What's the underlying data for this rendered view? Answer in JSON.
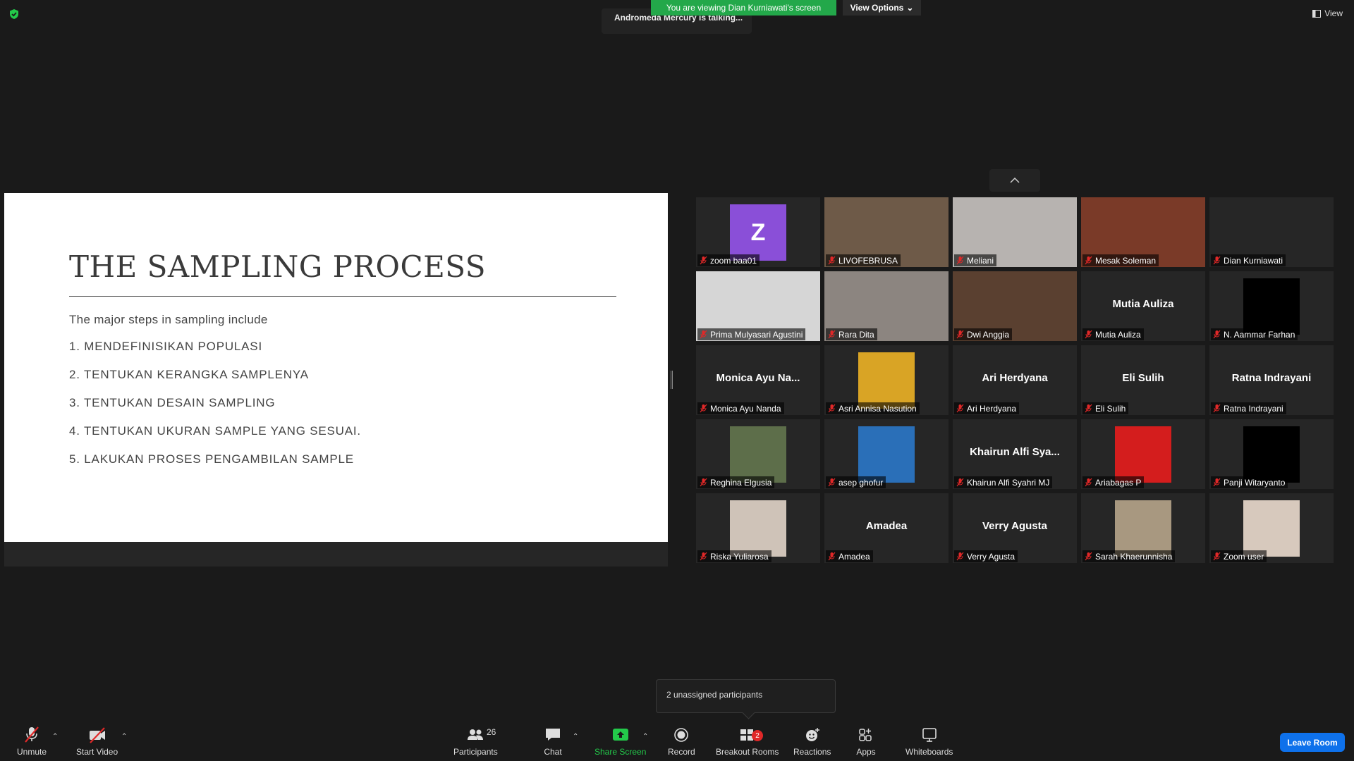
{
  "top": {
    "viewing_banner": "You are viewing Dian Kurniawati's screen",
    "view_options": "View Options",
    "talking": "Andromeda Mercury is talking...",
    "view_button": "View"
  },
  "slide": {
    "title": "THE SAMPLING PROCESS",
    "intro": "The major steps in sampling include",
    "steps": [
      "1. MENDEFINISIKAN POPULASI",
      "2. TENTUKAN KERANGKA SAMPLENYA",
      "3. TENTUKAN DESAIN SAMPLING",
      "4. TENTUKAN UKURAN SAMPLE YANG SESUAI.",
      "5. LAKUKAN PROSES PENGAMBILAN SAMPLE"
    ]
  },
  "gallery": [
    {
      "label": "zoom baa01",
      "center": "",
      "kind": "avatar",
      "avatar_letter": "Z"
    },
    {
      "label": "LIVOFEBRUSA",
      "center": "",
      "kind": "video",
      "video_color": "#6e5a48"
    },
    {
      "label": "Meliani",
      "center": "",
      "kind": "video",
      "video_color": "#b7b3b0"
    },
    {
      "label": "Mesak Soleman",
      "center": "",
      "kind": "video",
      "video_color": "#7a3a28"
    },
    {
      "label": "Dian Kurniawati",
      "center": "",
      "kind": "empty"
    },
    {
      "label": "Prima Mulyasari Agustini",
      "center": "",
      "kind": "video",
      "video_color": "#d6d6d6"
    },
    {
      "label": "Rara Dita",
      "center": "",
      "kind": "video",
      "video_color": "#8c8580"
    },
    {
      "label": "Dwi Anggia",
      "center": "",
      "kind": "video",
      "video_color": "#5a4030"
    },
    {
      "label": "Mutia Auliza",
      "center": "Mutia Auliza",
      "kind": "name"
    },
    {
      "label": "N. Aammar Farhan",
      "center": "",
      "kind": "pic",
      "pic_color": "#000000"
    },
    {
      "label": "Monica Ayu Nanda",
      "center": "Monica Ayu Na...",
      "kind": "name"
    },
    {
      "label": "Asri Annisa Nasution",
      "center": "",
      "kind": "pic",
      "pic_color": "#d9a425"
    },
    {
      "label": "Ari Herdyana",
      "center": "Ari Herdyana",
      "kind": "name"
    },
    {
      "label": "Eli Sulih",
      "center": "Eli Sulih",
      "kind": "name"
    },
    {
      "label": "Ratna Indrayani",
      "center": "Ratna Indrayani",
      "kind": "name"
    },
    {
      "label": "Reghina Elgusia",
      "center": "",
      "kind": "pic",
      "pic_color": "#5d6e4a"
    },
    {
      "label": "asep ghofur",
      "center": "",
      "kind": "pic",
      "pic_color": "#2a6fb8"
    },
    {
      "label": "Khairun Alfi Syahri MJ",
      "center": "Khairun Alfi Sya...",
      "kind": "name"
    },
    {
      "label": "Ariabagas P",
      "center": "",
      "kind": "pic",
      "pic_color": "#d41d1d"
    },
    {
      "label": "Panji Witaryanto",
      "center": "",
      "kind": "pic",
      "pic_color": "#000000"
    },
    {
      "label": "Riska Yuliarosa",
      "center": "",
      "kind": "pic",
      "pic_color": "#cfc3b8"
    },
    {
      "label": "Amadea",
      "center": "Amadea",
      "kind": "name"
    },
    {
      "label": "Verry Agusta",
      "center": "Verry Agusta",
      "kind": "name"
    },
    {
      "label": "Sarah Khaerunnisha",
      "center": "",
      "kind": "pic",
      "pic_color": "#a89880"
    },
    {
      "label": "Zoom user",
      "center": "",
      "kind": "pic",
      "pic_color": "#d7c9bd"
    }
  ],
  "unassigned": "2 unassigned participants",
  "toolbar": {
    "unmute": "Unmute",
    "start_video": "Start Video",
    "participants": "Participants",
    "participants_count": "26",
    "chat": "Chat",
    "share_screen": "Share Screen",
    "record": "Record",
    "breakout_rooms": "Breakout Rooms",
    "breakout_count": "2",
    "reactions": "Reactions",
    "apps": "Apps",
    "whiteboards": "Whiteboards",
    "leave_room": "Leave Room"
  },
  "colors": {
    "banner_green": "#23a84a",
    "leave_blue": "#0e71eb",
    "mute_red": "#e02828",
    "avatar_purple": "#8a4fd8"
  }
}
